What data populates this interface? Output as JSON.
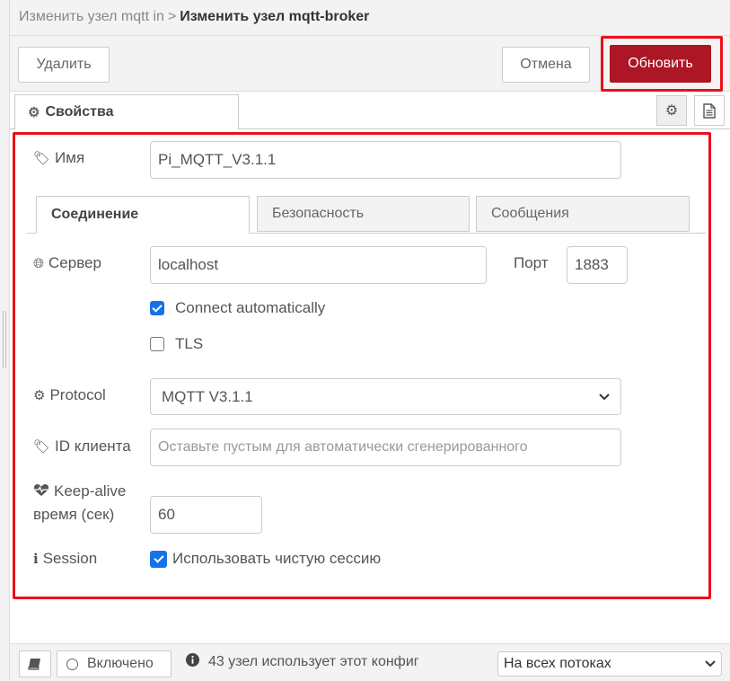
{
  "breadcrumb": {
    "parent": "Изменить узел mqtt in",
    "separator": ">",
    "current": "Изменить узел mqtt-broker"
  },
  "toolbar": {
    "delete_label": "Удалить",
    "cancel_label": "Отмена",
    "update_label": "Обновить"
  },
  "tabs": {
    "properties_label": "Свойства",
    "properties_icon": "gear-icon",
    "side_icons": [
      "gear-icon",
      "document-icon"
    ]
  },
  "form": {
    "name": {
      "label": "Имя",
      "icon": "tag-icon",
      "value": "Pi_MQTT_V3.1.1"
    },
    "subtabs": [
      "Соединение",
      "Безопасность",
      "Сообщения"
    ],
    "server": {
      "label": "Сервер",
      "icon": "globe-icon",
      "value": "localhost"
    },
    "port": {
      "label": "Порт",
      "value": "1883"
    },
    "connect_automatically": {
      "label": "Connect automatically",
      "checked": true
    },
    "tls": {
      "label": "TLS",
      "checked": false
    },
    "protocol": {
      "label": "Protocol",
      "icon": "gear-icon",
      "value": "MQTT V3.1.1"
    },
    "client_id": {
      "label": "ID клиента",
      "icon": "tag-icon",
      "placeholder": "Оставьте пустым для автоматически сгенерированного"
    },
    "keepalive": {
      "label_line1": "Keep-alive",
      "label_line2": "время (сек)",
      "icon": "heartbeat-icon",
      "value": "60"
    },
    "session": {
      "label": "Session",
      "icon": "info-icon",
      "checkbox_label": "Использовать чистую сессию",
      "checked": true
    }
  },
  "footer": {
    "enabled_label": "Включено",
    "usage_text": "43 узел использует этот конфиг",
    "scope_value": "На всех потоках"
  },
  "colors": {
    "accent_red": "#ad1625",
    "highlight": "#e8111c",
    "checkbox_blue": "#1473e6"
  }
}
